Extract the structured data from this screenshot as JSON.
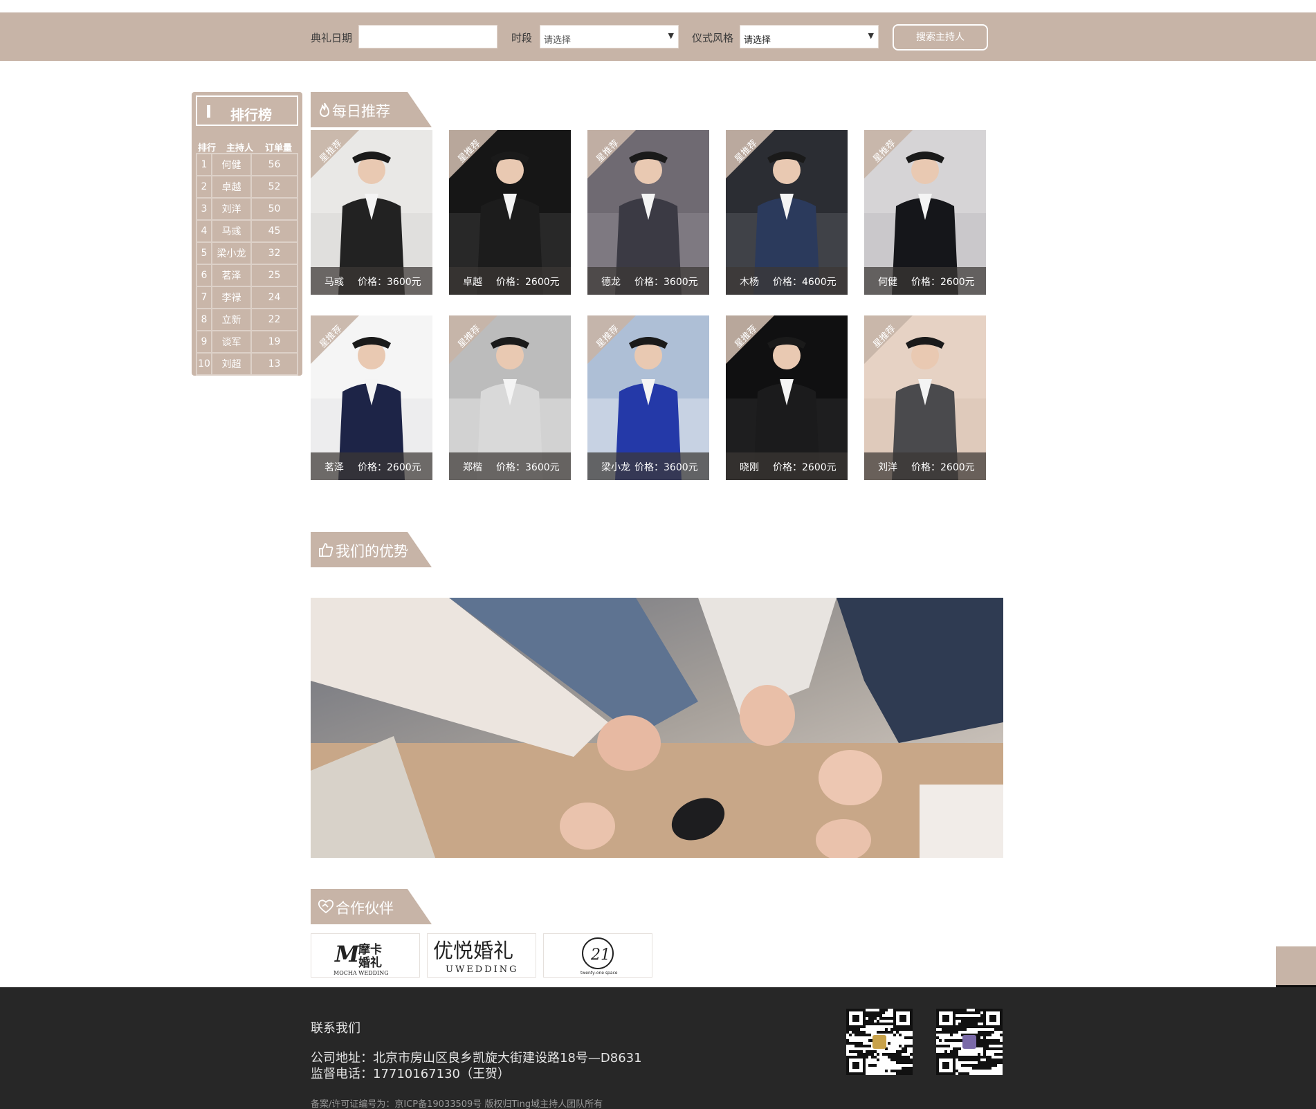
{
  "search": {
    "date_label": "典礼日期",
    "date_value": "",
    "period_label": "时段",
    "period_value": "请选择",
    "style_label": "仪式风格",
    "style_value": "请选择",
    "button_label": "搜索主持人"
  },
  "ranking": {
    "title": "排行榜",
    "col_rank": "排行",
    "col_host": "主持人",
    "col_orders": "订单量",
    "rows": [
      {
        "rank": "1",
        "name": "何健",
        "orders": "56"
      },
      {
        "rank": "2",
        "name": "卓越",
        "orders": "52"
      },
      {
        "rank": "3",
        "name": "刘洋",
        "orders": "50"
      },
      {
        "rank": "4",
        "name": "马彧",
        "orders": "45"
      },
      {
        "rank": "5",
        "name": "梁小龙",
        "orders": "32"
      },
      {
        "rank": "6",
        "name": "茗泽",
        "orders": "25"
      },
      {
        "rank": "7",
        "name": "李禄",
        "orders": "24"
      },
      {
        "rank": "8",
        "name": "立新",
        "orders": "22"
      },
      {
        "rank": "9",
        "name": "谈军",
        "orders": "19"
      },
      {
        "rank": "10",
        "name": "刘超",
        "orders": "13"
      }
    ]
  },
  "daily": {
    "title": "每日推荐",
    "ribbon": "星推荐",
    "price_label": "价格：",
    "cards": [
      {
        "name": "马彧",
        "price": "3600元"
      },
      {
        "name": "卓越",
        "price": "2600元"
      },
      {
        "name": "德龙",
        "price": "3600元"
      },
      {
        "name": "木杨",
        "price": "4600元"
      },
      {
        "name": "何健",
        "price": "2600元"
      },
      {
        "name": "茗泽",
        "price": "2600元"
      },
      {
        "name": "郑楷",
        "price": "3600元"
      },
      {
        "name": "梁小龙",
        "price": "3600元"
      },
      {
        "name": "晓刚",
        "price": "2600元"
      },
      {
        "name": "刘洋",
        "price": "2600元"
      }
    ]
  },
  "advantage": {
    "title": "我们的优势"
  },
  "partners": {
    "title": "合作伙伴",
    "logos": [
      {
        "name": "mocha",
        "text": "摩卡婚礼",
        "sub": "MOCHA WEDDING"
      },
      {
        "name": "uwedding",
        "text": "优悦婚礼",
        "sub": "UWEDDING"
      },
      {
        "name": "twentyone",
        "text": "21",
        "sub": "twenty-one space"
      }
    ]
  },
  "footer": {
    "contact_title": "联系我们",
    "address": "公司地址：北京市房山区良乡凯旋大街建设路18号—D8631",
    "phone": "监督电话：17710167130（王贺）",
    "icp": "备案/许可证编号为：京ICP备19033509号  版权归Ting域主持人团队所有"
  },
  "colors": {
    "accent": "#c7b4a7",
    "footer_bg": "#272727"
  }
}
